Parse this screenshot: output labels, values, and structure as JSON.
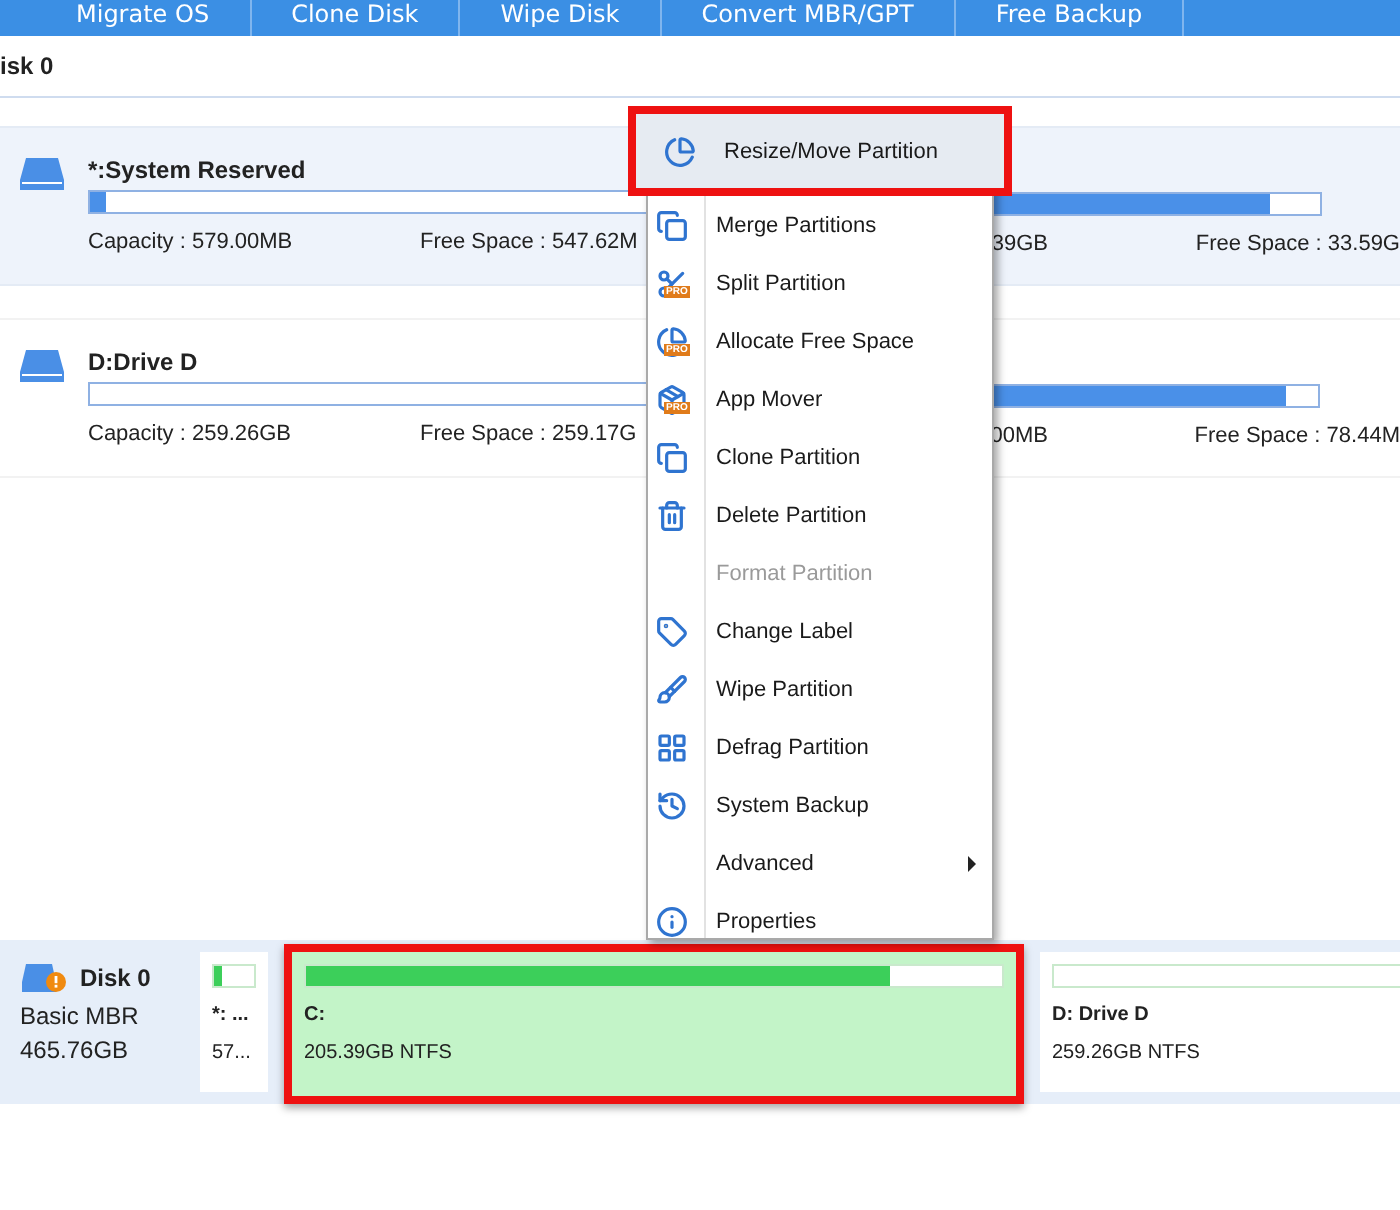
{
  "toolbar": {
    "items": [
      "Migrate OS",
      "Clone Disk",
      "Wipe Disk",
      "Convert MBR/GPT",
      "Free Backup"
    ]
  },
  "disk_header": {
    "title": "isk 0"
  },
  "partition_rows": [
    {
      "selected": true,
      "cards": [
        {
          "name": "*:System Reserved",
          "level": 0.03,
          "capacity": "Capacity : 579.00MB",
          "free": "Free Space : 547.62M"
        },
        {
          "level": 0.85,
          "capacity": "39GB",
          "free": "Free Space : 33.59G"
        }
      ]
    },
    {
      "selected": false,
      "cards": [
        {
          "name": "D:Drive D",
          "level": 0,
          "capacity": "Capacity : 259.26GB",
          "free": "Free Space : 259.17G"
        },
        {
          "level": 0.9,
          "capacity": "00MB",
          "free": "Free Space : 78.44M"
        }
      ]
    }
  ],
  "context_menu": [
    {
      "label": "Resize/Move Partition",
      "selected": true,
      "disabled": false,
      "kind": "item"
    },
    {
      "label": "Merge Partitions",
      "selected": false,
      "disabled": false,
      "kind": "item"
    },
    {
      "label": "Split Partition",
      "selected": false,
      "disabled": false,
      "kind": "item",
      "badge": "PRO"
    },
    {
      "label": "Allocate Free Space",
      "selected": false,
      "disabled": false,
      "kind": "item",
      "badge": "PRO"
    },
    {
      "label": "App Mover",
      "selected": false,
      "disabled": false,
      "kind": "item",
      "badge": "PRO"
    },
    {
      "label": "Clone Partition",
      "selected": false,
      "disabled": false,
      "kind": "item"
    },
    {
      "label": "Delete Partition",
      "selected": false,
      "disabled": false,
      "kind": "item"
    },
    {
      "label": "Format Partition",
      "selected": false,
      "disabled": true,
      "kind": "item"
    },
    {
      "label": "Change Label",
      "selected": false,
      "disabled": false,
      "kind": "item"
    },
    {
      "label": "Wipe Partition",
      "selected": false,
      "disabled": false,
      "kind": "item"
    },
    {
      "label": "Defrag Partition",
      "selected": false,
      "disabled": false,
      "kind": "item"
    },
    {
      "label": "System Backup",
      "selected": false,
      "disabled": false,
      "kind": "item"
    },
    {
      "label": "Advanced",
      "selected": false,
      "disabled": false,
      "kind": "submenu"
    },
    {
      "label": "Properties",
      "selected": false,
      "disabled": false,
      "kind": "item"
    }
  ],
  "disk_map": {
    "name": "Disk 0",
    "type": "Basic MBR",
    "size": "465.76GB",
    "partitions": [
      {
        "name": "*: ...",
        "size": "57...",
        "level": 0.2,
        "selected": false
      },
      {
        "name": "C:",
        "size": "205.39GB NTFS",
        "level": 0.84,
        "selected": true
      },
      {
        "name": "D: Drive D",
        "size": "259.26GB NTFS",
        "level": 0,
        "selected": false
      }
    ]
  }
}
